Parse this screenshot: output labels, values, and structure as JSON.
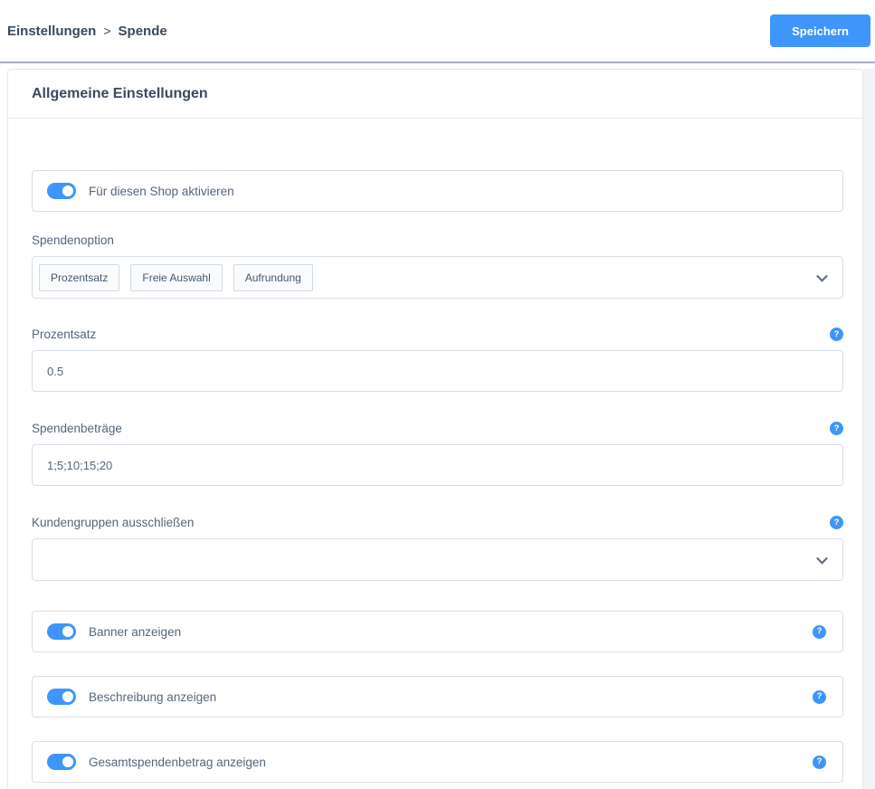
{
  "topbar": {
    "breadcrumb": {
      "parent": "Einstellungen",
      "separator": ">",
      "current": "Spende"
    },
    "save_button": "Speichern"
  },
  "card": {
    "title": "Allgemeine Einstellungen"
  },
  "icons": {
    "help": "?"
  },
  "fields": {
    "activate": {
      "label": "Für diesen Shop aktivieren",
      "enabled": true
    },
    "donation_option": {
      "label": "Spendenoption",
      "selected": [
        "Prozentsatz",
        "Freie Auswahl",
        "Aufrundung"
      ]
    },
    "percentage": {
      "label": "Prozentsatz",
      "value": "0.5"
    },
    "donation_amounts": {
      "label": "Spendenbeträge",
      "value": "1;5;10;15;20"
    },
    "exclude_customer_groups": {
      "label": "Kundengruppen ausschließen",
      "value": ""
    },
    "show_banner": {
      "label": "Banner anzeigen",
      "enabled": true
    },
    "show_description": {
      "label": "Beschreibung anzeigen",
      "enabled": true
    },
    "show_total": {
      "label": "Gesamtspendenbetrag anzeigen",
      "enabled": true
    }
  },
  "colors": {
    "accent": "#3e96fa",
    "breadcrumb_text": "#394b5e",
    "label_text": "#54667b",
    "divider": "#a6afba"
  }
}
